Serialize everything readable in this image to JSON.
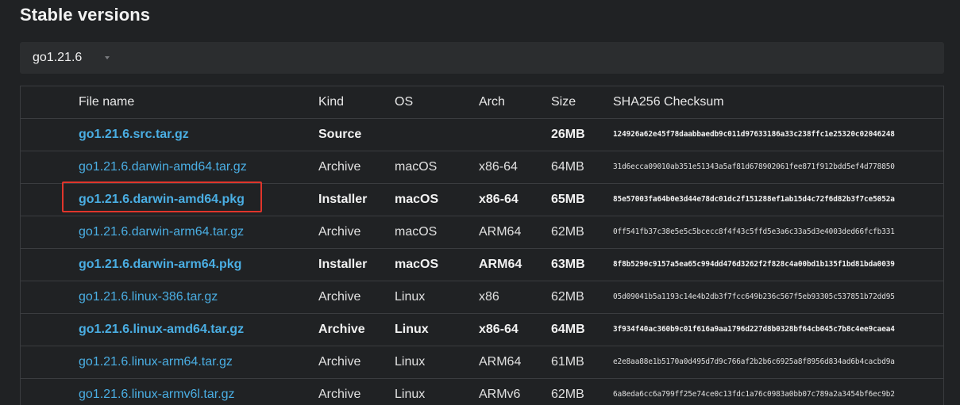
{
  "section_title": "Stable versions",
  "version_selector": {
    "value": "go1.21.6",
    "icon": "chevron-down-icon"
  },
  "table": {
    "headers": {
      "file": "File name",
      "kind": "Kind",
      "os": "OS",
      "arch": "Arch",
      "size": "Size",
      "sha": "SHA256 Checksum"
    },
    "rows": [
      {
        "file": "go1.21.6.src.tar.gz",
        "kind": "Source",
        "os": "",
        "arch": "",
        "size": "26MB",
        "sha": "124926a62e45f78daabbaedb9c011d97633186a33c238ffc1e25320c02046248",
        "featured": true
      },
      {
        "file": "go1.21.6.darwin-amd64.tar.gz",
        "kind": "Archive",
        "os": "macOS",
        "arch": "x86-64",
        "size": "64MB",
        "sha": "31d6ecca09010ab351e51343a5af81d678902061fee871f912bdd5ef4d778850",
        "featured": false
      },
      {
        "file": "go1.21.6.darwin-amd64.pkg",
        "kind": "Installer",
        "os": "macOS",
        "arch": "x86-64",
        "size": "65MB",
        "sha": "85e57003fa64b0e3d44e78dc01dc2f151288ef1ab15d4c72f6d82b3f7ce5052a",
        "featured": true
      },
      {
        "file": "go1.21.6.darwin-arm64.tar.gz",
        "kind": "Archive",
        "os": "macOS",
        "arch": "ARM64",
        "size": "62MB",
        "sha": "0ff541fb37c38e5e5c5bcecc8f4f43c5ffd5e3a6c33a5d3e4003ded66fcfb331",
        "featured": false
      },
      {
        "file": "go1.21.6.darwin-arm64.pkg",
        "kind": "Installer",
        "os": "macOS",
        "arch": "ARM64",
        "size": "63MB",
        "sha": "8f8b5290c9157a5ea65c994dd476d3262f2f828c4a00bd1b135f1bd81bda0039",
        "featured": true
      },
      {
        "file": "go1.21.6.linux-386.tar.gz",
        "kind": "Archive",
        "os": "Linux",
        "arch": "x86",
        "size": "62MB",
        "sha": "05d09041b5a1193c14e4b2db3f7fcc649b236c567f5eb93305c537851b72dd95",
        "featured": false
      },
      {
        "file": "go1.21.6.linux-amd64.tar.gz",
        "kind": "Archive",
        "os": "Linux",
        "arch": "x86-64",
        "size": "64MB",
        "sha": "3f934f40ac360b9c01f616a9aa1796d227d8b0328bf64cb045c7b8c4ee9caea4",
        "featured": true
      },
      {
        "file": "go1.21.6.linux-arm64.tar.gz",
        "kind": "Archive",
        "os": "Linux",
        "arch": "ARM64",
        "size": "61MB",
        "sha": "e2e8aa88e1b5170a0d495d7d9c766af2b2b6c6925a8f8956d834ad6b4cacbd9a",
        "featured": false
      },
      {
        "file": "go1.21.6.linux-armv6l.tar.gz",
        "kind": "Archive",
        "os": "Linux",
        "arch": "ARMv6",
        "size": "62MB",
        "sha": "6a8eda6cc6a799ff25e74ce0c13fdc1a76c0983a0bb07c789a2a3454bf6ec9b2",
        "featured": false
      }
    ]
  },
  "highlight": {
    "row_index": 2,
    "color": "#e0352b"
  },
  "colors": {
    "background": "#202224",
    "link": "#4aaee3",
    "border": "#3a3c3f"
  }
}
